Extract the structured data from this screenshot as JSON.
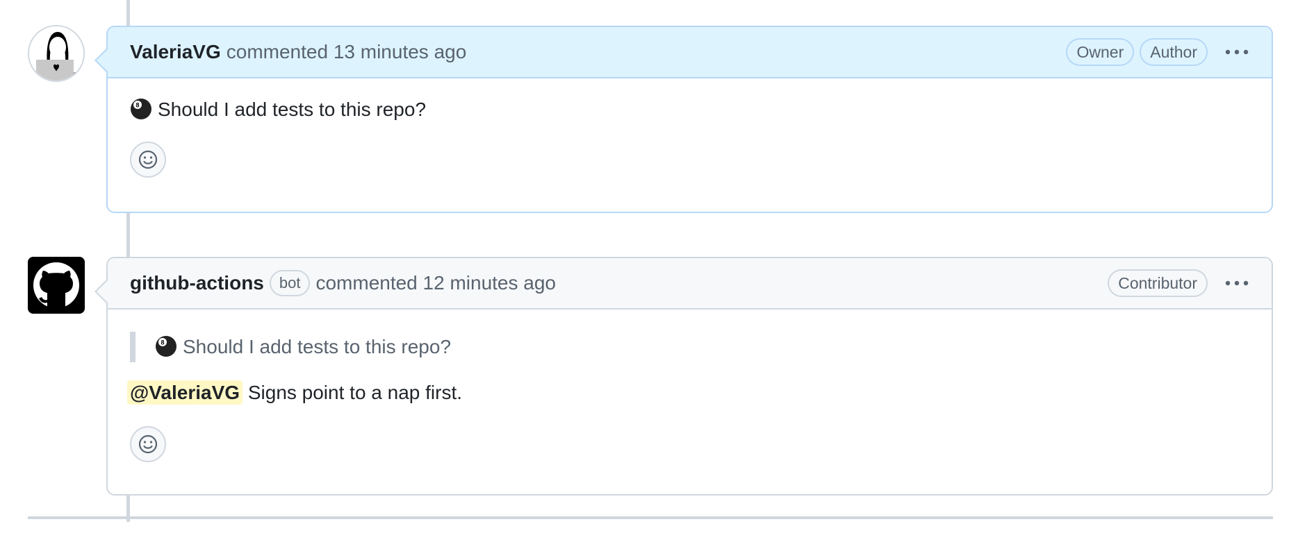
{
  "comments": [
    {
      "author": "ValeriaVG",
      "meta": "commented 13 minutes ago",
      "labels": [
        "Owner",
        "Author"
      ],
      "body_text": "Should I add tests to this repo?",
      "emoji_icon": "8-ball-icon",
      "avatar_icon": "person-laptop-avatar"
    },
    {
      "author": "github-actions",
      "bot_label": "bot",
      "meta": "commented 12 minutes ago",
      "labels": [
        "Contributor"
      ],
      "quote_text": "Should I add tests to this repo?",
      "mention": "@ValeriaVG",
      "reply_text": "Signs point to a nap first.",
      "emoji_icon": "8-ball-icon",
      "avatar_icon": "github-octocat-icon"
    }
  ],
  "colors": {
    "highlight_header": "#ddf4ff",
    "border": "#d0d7de",
    "mention_bg": "#fff8c5",
    "muted_text": "#59636e"
  }
}
